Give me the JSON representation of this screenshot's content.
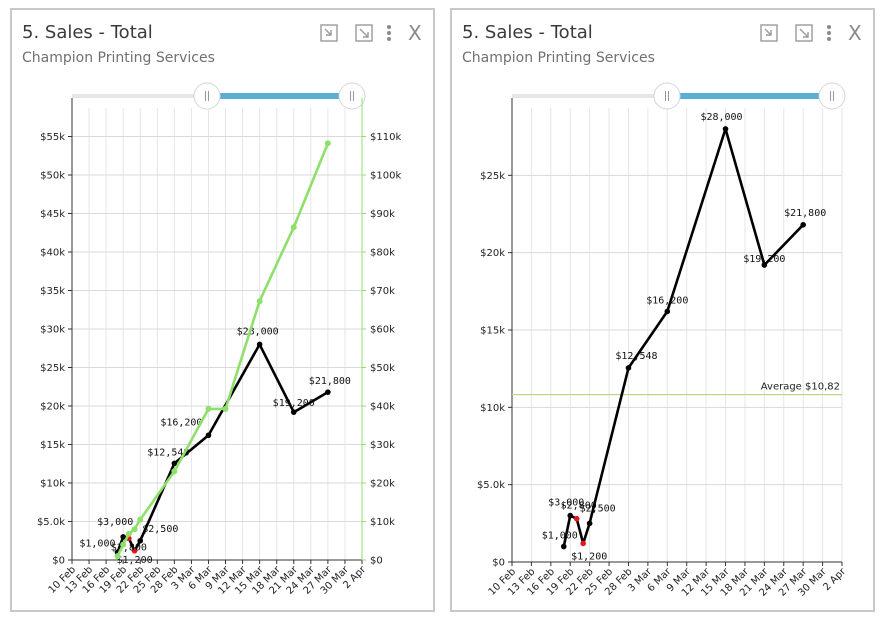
{
  "panels": [
    {
      "title": "5. Sales - Total",
      "subtitle": "Champion Printing Services",
      "close_label": "X",
      "icons": [
        "collapse-icon",
        "expand-icon",
        "more-vert-icon"
      ]
    },
    {
      "title": "5. Sales - Total",
      "subtitle": "Champion Printing Services",
      "close_label": "X",
      "icons": [
        "collapse-icon",
        "expand-icon",
        "more-vert-icon"
      ]
    }
  ],
  "colors": {
    "sales": "#000000",
    "cumulative": "#8ee06a",
    "highlight": "#e8141b",
    "range": "#5aafd6",
    "average": "#b7d98a"
  },
  "chart_data": [
    {
      "type": "line",
      "x_ticks": [
        "10 Feb",
        "13 Feb",
        "16 Feb",
        "19 Feb",
        "22 Feb",
        "25 Feb",
        "28 Feb",
        "3 Mar",
        "6 Mar",
        "9 Mar",
        "12 Mar",
        "15 Mar",
        "18 Mar",
        "21 Mar",
        "24 Mar",
        "27 Mar",
        "30 Mar",
        "2 Apr"
      ],
      "y_ticks": [
        "$0",
        "$5.0k",
        "$10k",
        "$15k",
        "$20k",
        "$25k",
        "$30k",
        "$35k",
        "$40k",
        "$45k",
        "$50k",
        "$55k"
      ],
      "y2_ticks": [
        "$0",
        "$10k",
        "$20k",
        "$30k",
        "$40k",
        "$50k",
        "$60k",
        "$70k",
        "$80k",
        "$90k",
        "$100k",
        "$110k"
      ],
      "ylim": [
        0,
        60000
      ],
      "y2lim": [
        0,
        120000
      ],
      "series": [
        {
          "axis": "left",
          "x": [
            "18 Feb",
            "19 Feb",
            "20 Feb",
            "21 Feb",
            "22 Feb",
            "28 Feb",
            "6 Mar",
            "9 Mar",
            "15 Mar",
            "21 Mar",
            "27 Mar"
          ],
          "values": [
            1000,
            3000,
            2800,
            1200,
            2500,
            12548,
            16200,
            null,
            28000,
            19200,
            21800
          ],
          "labels": [
            "$1,000",
            "$3,000",
            "$2,800",
            "$1,200",
            "$2,500",
            "$12,548",
            "$16,200",
            "",
            "$28,000",
            "$19,200",
            "$21,800"
          ]
        },
        {
          "axis": "right",
          "x": [
            "18 Feb",
            "19 Feb",
            "20 Feb",
            "21 Feb",
            "22 Feb",
            "28 Feb",
            "6 Mar",
            "9 Mar",
            "15 Mar",
            "21 Mar",
            "27 Mar"
          ],
          "values": [
            1000,
            4000,
            6800,
            8000,
            10500,
            23048,
            39248,
            39248,
            67248,
            86448,
            108248
          ]
        }
      ],
      "range_selector": {
        "start": 0.5,
        "end": 1.0
      }
    },
    {
      "type": "line",
      "x_ticks": [
        "10 Feb",
        "13 Feb",
        "16 Feb",
        "19 Feb",
        "22 Feb",
        "25 Feb",
        "28 Feb",
        "3 Mar",
        "6 Mar",
        "9 Mar",
        "12 Mar",
        "15 Mar",
        "18 Mar",
        "21 Mar",
        "24 Mar",
        "27 Mar",
        "30 Mar",
        "2 Apr"
      ],
      "y_ticks": [
        "$0",
        "$5.0k",
        "$10k",
        "$15k",
        "$20k",
        "$25k"
      ],
      "ylim": [
        0,
        30000
      ],
      "series": [
        {
          "x": [
            "18 Feb",
            "19 Feb",
            "20 Feb",
            "21 Feb",
            "22 Feb",
            "28 Feb",
            "6 Mar",
            "15 Mar",
            "21 Mar",
            "27 Mar"
          ],
          "values": [
            1000,
            3000,
            2800,
            1200,
            2500,
            12548,
            16200,
            28000,
            19200,
            21800
          ],
          "labels": [
            "$1,000",
            "$3,000",
            "$2,800",
            "$1,200",
            "$2,500",
            "$12,548",
            "$16,200",
            "$28,000",
            "$19,200",
            "$21,800"
          ]
        }
      ],
      "average": {
        "value": 10820,
        "label": "Average $10,82"
      },
      "range_selector": {
        "start": 0.5,
        "end": 1.0
      }
    }
  ]
}
